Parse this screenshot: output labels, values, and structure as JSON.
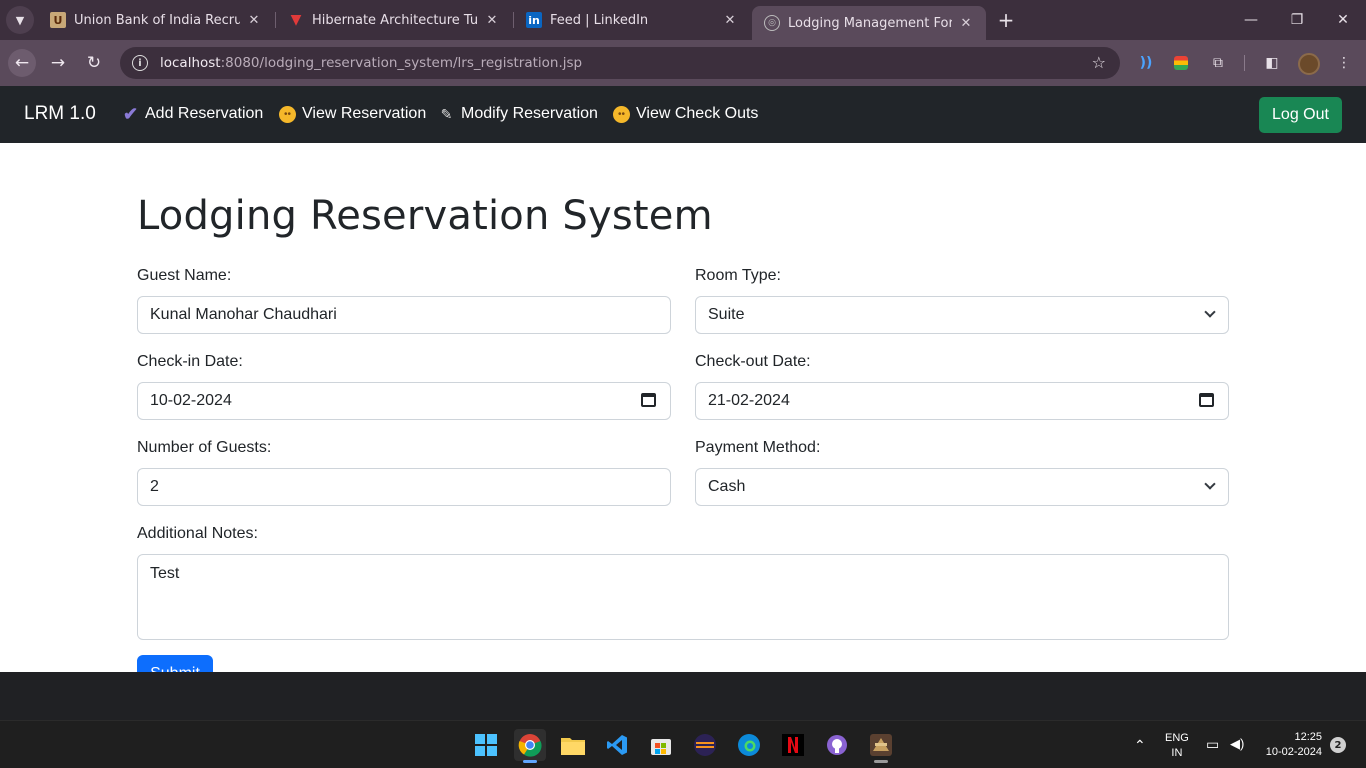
{
  "browser": {
    "tabs": [
      {
        "title": "Union Bank of India Recruitment",
        "favicon": "union-bank-favicon"
      },
      {
        "title": "Hibernate Architecture Tutorial",
        "favicon": "hibernate-favicon"
      },
      {
        "title": "Feed | LinkedIn",
        "favicon": "linkedin-favicon"
      },
      {
        "title": "Lodging Management Form",
        "favicon": "globe-favicon",
        "active": true
      }
    ],
    "url_host": "localhost",
    "url_rest": ":8080/lodging_reservation_system/lrs_registration.jsp"
  },
  "navbar": {
    "brand": "LRM 1.0",
    "items": [
      {
        "label": "Add Reservation",
        "icon": "checkmark-icon"
      },
      {
        "label": "View Reservation",
        "icon": "face-icon"
      },
      {
        "label": "Modify Reservation",
        "icon": "pencil-icon"
      },
      {
        "label": "View Check Outs",
        "icon": "face-icon"
      }
    ],
    "logout_label": "Log Out",
    "logout_color": "#198754"
  },
  "form": {
    "heading": "Lodging Reservation System",
    "guest_name": {
      "label": "Guest Name:",
      "value": "Kunal Manohar Chaudhari"
    },
    "room_type": {
      "label": "Room Type:",
      "value": "Suite"
    },
    "check_in": {
      "label": "Check-in Date:",
      "value": "10-02-2024"
    },
    "check_out": {
      "label": "Check-out Date:",
      "value": "21-02-2024"
    },
    "guests": {
      "label": "Number of Guests:",
      "value": "2"
    },
    "payment": {
      "label": "Payment Method:",
      "value": "Cash"
    },
    "notes": {
      "label": "Additional Notes:",
      "value": "Test"
    },
    "submit_label": "Submit",
    "submit_color": "#0d6efd"
  },
  "taskbar": {
    "language": "ENG",
    "region": "IN",
    "time": "12:25",
    "date": "10-02-2024",
    "notification_count": "2"
  }
}
